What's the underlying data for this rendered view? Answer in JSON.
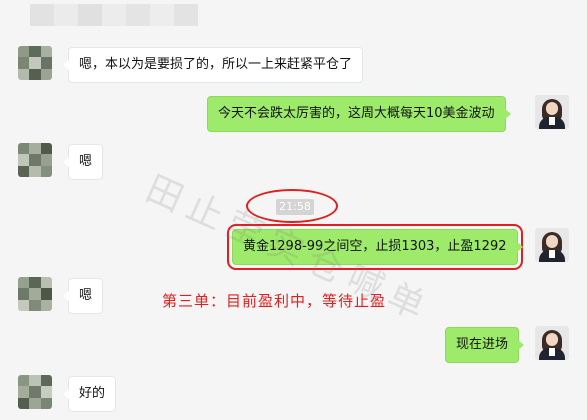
{
  "messages": [
    {
      "side": "in",
      "text": "嗯，本以为是要损了的，所以一上来赶紧平仓了"
    },
    {
      "side": "out",
      "text": "今天不会跌太厉害的，这周大概每天10美金波动"
    },
    {
      "side": "in",
      "text": "嗯"
    },
    {
      "side": "out",
      "text": "黄金1298-99之间空，止损1303，止盈1292",
      "highlight": true
    },
    {
      "side": "in",
      "text": "嗯"
    },
    {
      "side": "out",
      "text": "现在进场"
    },
    {
      "side": "in",
      "text": "好的"
    }
  ],
  "timestamp": "21:58",
  "annotation": "第三单：目前盈利中，等待止盈",
  "watermark": "田止莹实仓喊单",
  "colors": {
    "outgoing_bubble": "#9eea6a",
    "incoming_bubble": "#ffffff",
    "highlight": "#e02020",
    "background": "#f5f5f5"
  }
}
